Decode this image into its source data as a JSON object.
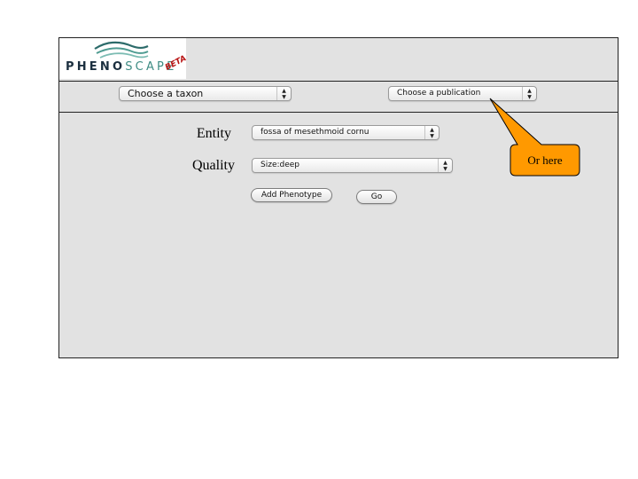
{
  "app": {
    "logo": {
      "text_dark": "PHENO",
      "text_light": "SCAPE",
      "badge": "BETA"
    }
  },
  "toolbar": {
    "taxon_select": {
      "value": "Choose a taxon"
    },
    "publication_select": {
      "value": "Choose a publication"
    }
  },
  "form": {
    "entity": {
      "label": "Entity",
      "value": "fossa of mesethmoid cornu"
    },
    "quality": {
      "label": "Quality",
      "value": "Size:deep"
    },
    "add_phenotype_label": "Add Phenotype",
    "go_label": "Go"
  },
  "callout": {
    "text": "Or here",
    "color": "#ff9900"
  },
  "icons": {
    "select_arrows": "updown-arrows-icon",
    "logo_mark": "waves-icon"
  }
}
